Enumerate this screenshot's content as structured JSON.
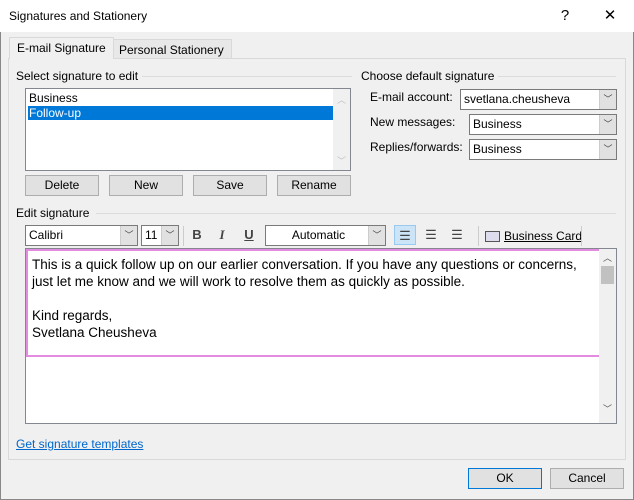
{
  "window": {
    "title": "Signatures and Stationery",
    "help": "?",
    "close": "✕"
  },
  "tabs": [
    {
      "label": "E-mail Signature",
      "active": true
    },
    {
      "label": "Personal Stationery",
      "active": false
    }
  ],
  "select": {
    "label": "Select signature to edit",
    "items": [
      "Business",
      "Follow-up"
    ],
    "selected": "Follow-up"
  },
  "buttons": {
    "delete": "Delete",
    "new": "New",
    "save": "Save",
    "rename": "Rename"
  },
  "defaults": {
    "label": "Choose default signature",
    "account_label": "E-mail account:",
    "account": "svetlana.cheusheva",
    "new_label": "New messages:",
    "new_value": "Business",
    "replies_label": "Replies/forwards:",
    "replies_value": "Business"
  },
  "edit": {
    "label": "Edit signature",
    "font": "Calibri",
    "size": "11",
    "bold": "B",
    "italic": "I",
    "underline": "U",
    "color": "Automatic",
    "business_card": "Business Card",
    "lines": [
      "This is a quick follow up on our earlier conversation. If you have any questions or concerns,",
      "just let me know and we will work to resolve them as quickly as possible.",
      "",
      "Kind regards,",
      "Svetlana Cheusheva"
    ]
  },
  "link": "Get signature templates",
  "footer": {
    "ok": "OK",
    "cancel": "Cancel"
  },
  "colors": {
    "selection": "#0078d7",
    "signature_border": "#e28be0",
    "link": "#0066cc"
  }
}
